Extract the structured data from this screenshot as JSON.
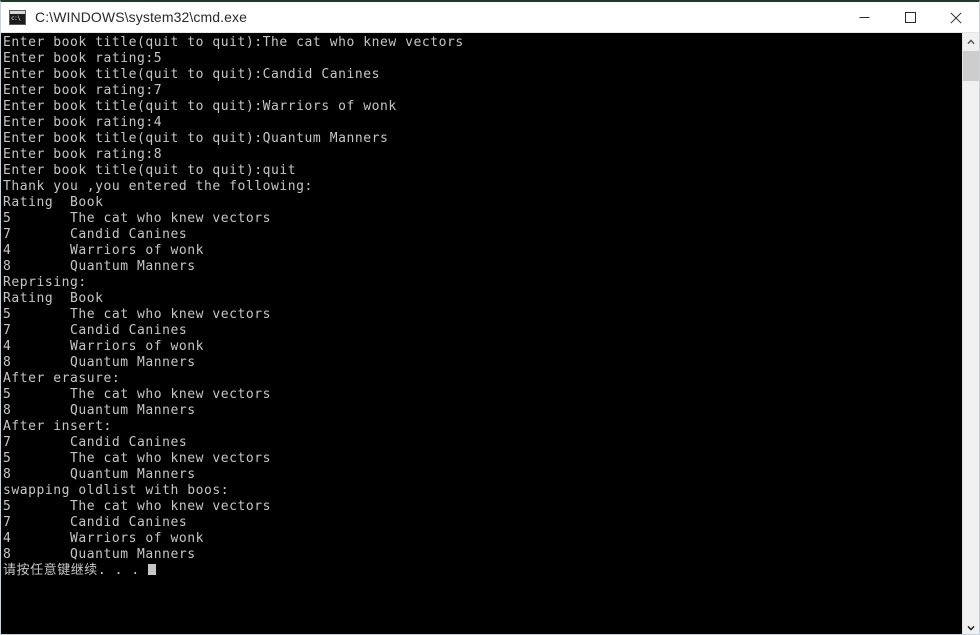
{
  "window": {
    "title": "C:\\WINDOWS\\system32\\cmd.exe",
    "icon": "cmd-console-icon",
    "controls": {
      "minimize": "Minimize",
      "maximize": "Maximize",
      "close": "Close"
    }
  },
  "console": {
    "background_color": "#000000",
    "foreground_color": "#c6c6c6",
    "lines": [
      "Enter book title(quit to quit):The cat who knew vectors",
      "Enter book rating:5",
      "Enter book title(quit to quit):Candid Canines",
      "Enter book rating:7",
      "Enter book title(quit to quit):Warriors of wonk",
      "Enter book rating:4",
      "Enter book title(quit to quit):Quantum Manners",
      "Enter book rating:8",
      "Enter book title(quit to quit):quit",
      "Thank you ,you entered the following:",
      "Rating  Book",
      "5       The cat who knew vectors",
      "7       Candid Canines",
      "4       Warriors of wonk",
      "8       Quantum Manners",
      "Reprising:",
      "Rating  Book",
      "5       The cat who knew vectors",
      "7       Candid Canines",
      "4       Warriors of wonk",
      "8       Quantum Manners",
      "After erasure:",
      "5       The cat who knew vectors",
      "8       Quantum Manners",
      "After insert:",
      "7       Candid Canines",
      "5       The cat who knew vectors",
      "8       Quantum Manners",
      "swapping oldlist with boos:",
      "5       The cat who knew vectors",
      "7       Candid Canines",
      "4       Warriors of wonk",
      "8       Quantum Manners",
      "请按任意键继续. . ."
    ],
    "cursor_visible": true
  },
  "scrollbar": {
    "up_arrow": "scroll-up",
    "down_arrow": "scroll-down",
    "thumb": "scroll-thumb"
  }
}
